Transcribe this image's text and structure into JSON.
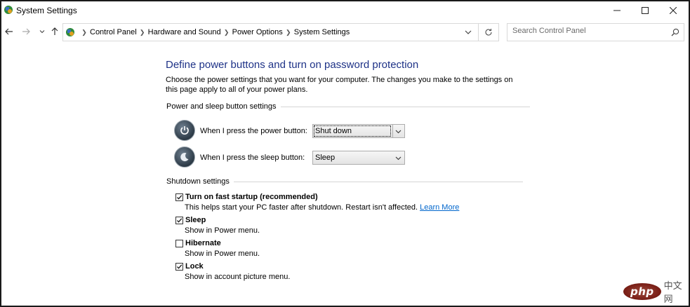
{
  "window": {
    "title": "System Settings",
    "controls": {
      "minimize": "minimize-icon",
      "maximize": "maximize-icon",
      "close": "close-icon"
    }
  },
  "nav": {
    "back": "arrow-left-icon",
    "forward": "arrow-right-icon",
    "recent": "chevron-down-icon",
    "up": "arrow-up-icon"
  },
  "address": {
    "breadcrumbs": [
      "Control Panel",
      "Hardware and Sound",
      "Power Options",
      "System Settings"
    ]
  },
  "search": {
    "placeholder": "Search Control Panel"
  },
  "content": {
    "title": "Define power buttons and turn on password protection",
    "description": "Choose the power settings that you want for your computer. The changes you make to the settings on this page apply to all of your power plans.",
    "power_section": {
      "heading": "Power and sleep button settings",
      "power_button": {
        "label": "When I press the power button:",
        "value": "Shut down"
      },
      "sleep_button": {
        "label": "When I press the sleep button:",
        "value": "Sleep"
      }
    },
    "shutdown_section": {
      "heading": "Shutdown settings",
      "options": [
        {
          "title": "Turn on fast startup (recommended)",
          "desc": "This helps start your PC faster after shutdown. Restart isn't affected.",
          "link": "Learn More",
          "checked": true
        },
        {
          "title": "Sleep",
          "desc": "Show in Power menu.",
          "checked": true
        },
        {
          "title": "Hibernate",
          "desc": "Show in Power menu.",
          "checked": false
        },
        {
          "title": "Lock",
          "desc": "Show in account picture menu.",
          "checked": true
        }
      ]
    }
  },
  "watermark": {
    "logo": "php",
    "text": "中文网"
  },
  "colors": {
    "title_blue": "#1e3287",
    "link_blue": "#0066cc",
    "border": "#d9d9d9"
  }
}
